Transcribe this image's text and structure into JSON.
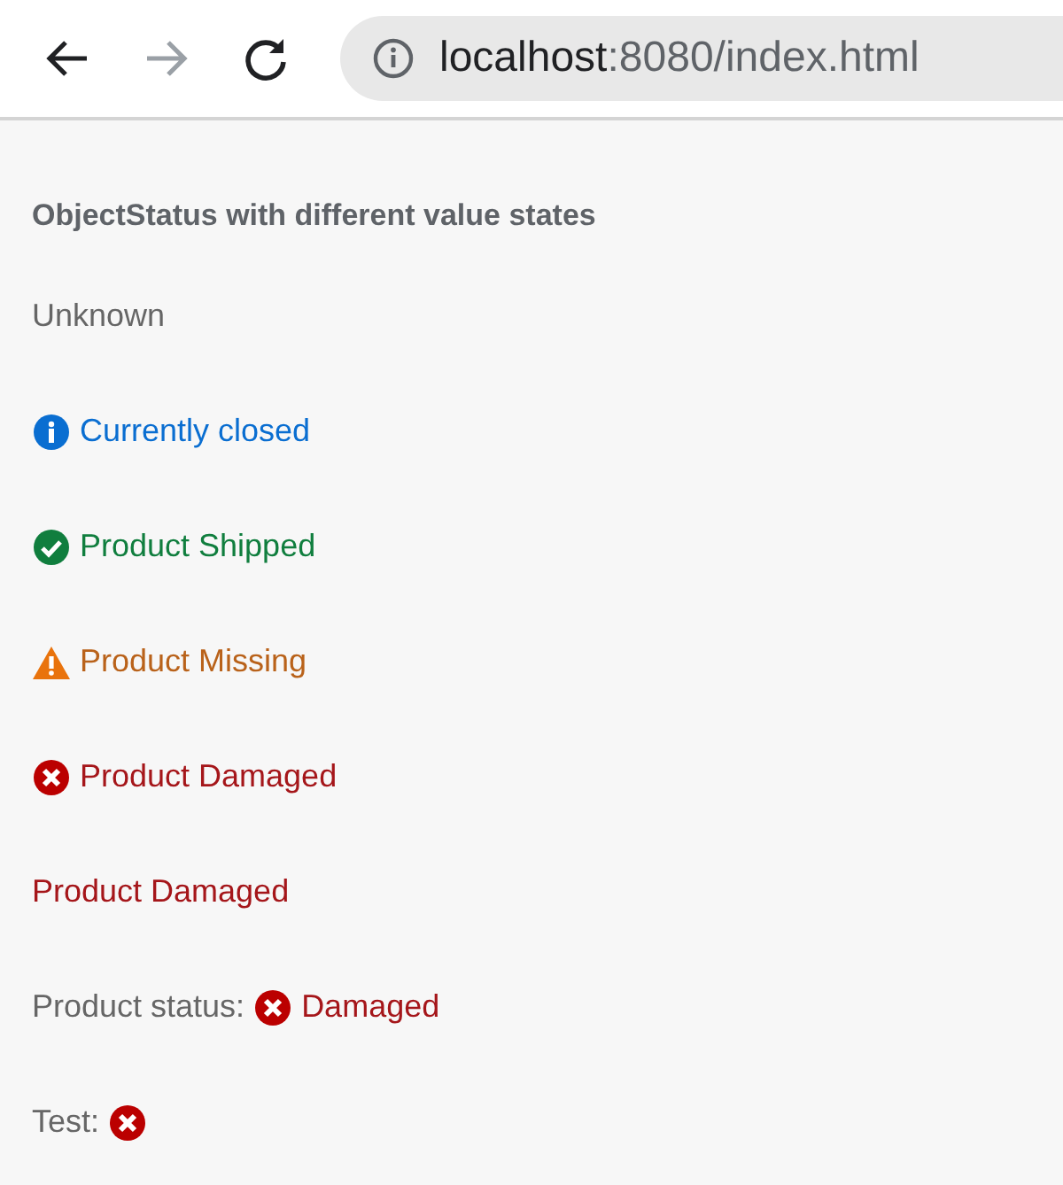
{
  "browser": {
    "url_host": "localhost",
    "url_path": ":8080/index.html",
    "forward_disabled": true
  },
  "page": {
    "title": "ObjectStatus with different value states",
    "statuses": [
      {
        "text": "Unknown",
        "kind": "none",
        "icon": false
      },
      {
        "text": "Currently closed",
        "kind": "information",
        "icon": true
      },
      {
        "text": "Product Shipped",
        "kind": "success",
        "icon": true
      },
      {
        "text": "Product Missing",
        "kind": "warning",
        "icon": true
      },
      {
        "text": "Product Damaged",
        "kind": "error",
        "icon": true
      },
      {
        "text": "Product Damaged",
        "kind": "error",
        "icon": false
      },
      {
        "label": "Product status:",
        "text": "Damaged",
        "kind": "error",
        "icon": true
      },
      {
        "label": "Test:",
        "kind": "error",
        "icon": true
      }
    ]
  }
}
